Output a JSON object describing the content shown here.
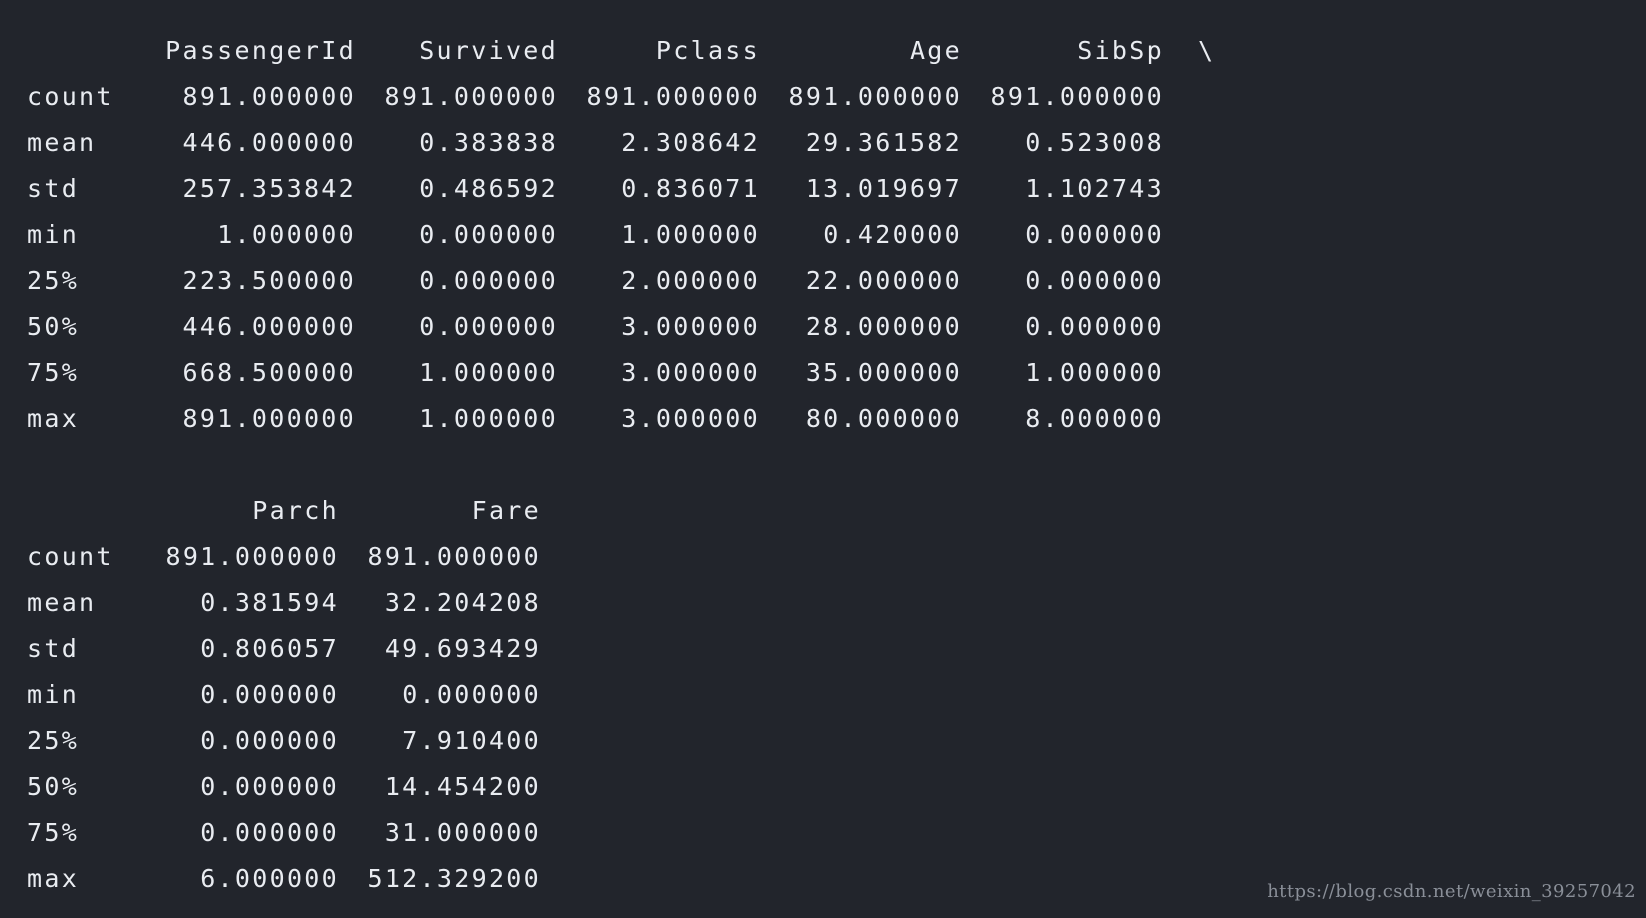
{
  "table_a": {
    "columns": [
      "PassengerId",
      "Survived",
      "Pclass",
      "Age",
      "SibSp"
    ],
    "continuation": "\\",
    "rows": [
      {
        "label": "count",
        "values": [
          "891.000000",
          "891.000000",
          "891.000000",
          "891.000000",
          "891.000000"
        ]
      },
      {
        "label": "mean",
        "values": [
          "446.000000",
          "0.383838",
          "2.308642",
          "29.361582",
          "0.523008"
        ]
      },
      {
        "label": "std",
        "values": [
          "257.353842",
          "0.486592",
          "0.836071",
          "13.019697",
          "1.102743"
        ]
      },
      {
        "label": "min",
        "values": [
          "1.000000",
          "0.000000",
          "1.000000",
          "0.420000",
          "0.000000"
        ]
      },
      {
        "label": "25%",
        "values": [
          "223.500000",
          "0.000000",
          "2.000000",
          "22.000000",
          "0.000000"
        ]
      },
      {
        "label": "50%",
        "values": [
          "446.000000",
          "0.000000",
          "3.000000",
          "28.000000",
          "0.000000"
        ]
      },
      {
        "label": "75%",
        "values": [
          "668.500000",
          "1.000000",
          "3.000000",
          "35.000000",
          "1.000000"
        ]
      },
      {
        "label": "max",
        "values": [
          "891.000000",
          "1.000000",
          "3.000000",
          "80.000000",
          "8.000000"
        ]
      }
    ]
  },
  "table_b": {
    "columns": [
      "Parch",
      "Fare"
    ],
    "rows": [
      {
        "label": "count",
        "values": [
          "891.000000",
          "891.000000"
        ]
      },
      {
        "label": "mean",
        "values": [
          "0.381594",
          "32.204208"
        ]
      },
      {
        "label": "std",
        "values": [
          "0.806057",
          "49.693429"
        ]
      },
      {
        "label": "min",
        "values": [
          "0.000000",
          "0.000000"
        ]
      },
      {
        "label": "25%",
        "values": [
          "0.000000",
          "7.910400"
        ]
      },
      {
        "label": "50%",
        "values": [
          "0.000000",
          "14.454200"
        ]
      },
      {
        "label": "75%",
        "values": [
          "0.000000",
          "31.000000"
        ]
      },
      {
        "label": "max",
        "values": [
          "6.000000",
          "512.329200"
        ]
      }
    ]
  },
  "watermark": "https://blog.csdn.net/weixin_39257042",
  "colors": {
    "background": "#22252c",
    "text": "#e9ecf1",
    "watermark": "#8a8f98"
  }
}
